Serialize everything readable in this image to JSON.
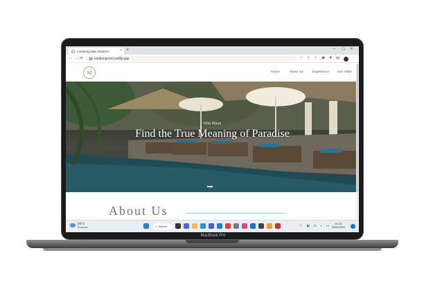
{
  "device": {
    "brand_label": "MacBook Pro"
  },
  "browser": {
    "tab_title": "Lumbung Mas Tentrem",
    "tab_close": "×",
    "new_tab": "+",
    "url": "lumbungmas.netlify.app",
    "window_controls": {
      "minimize": "–",
      "maximize": "▢",
      "close": "✕"
    },
    "nav": {
      "back": "←",
      "forward": "→",
      "reload": "⟳"
    }
  },
  "site": {
    "logo_text": "M",
    "nav_links": [
      "Home",
      "About Us",
      "Experience",
      "Our Villas"
    ],
    "hero": {
      "kicker": "Villa Maya",
      "title": "Find the True Meaning of Paradise"
    },
    "section_title": "About Us"
  },
  "taskbar": {
    "weather_temp": "29°C",
    "weather_desc": "Berawan",
    "search_label": "Search",
    "clock_time": "14.16",
    "clock_date": "23/02/2022"
  },
  "colors": {
    "accent_gold": "#b8a47c",
    "divider_teal": "#9fd3d9",
    "taskbar": "#e9eef4"
  }
}
